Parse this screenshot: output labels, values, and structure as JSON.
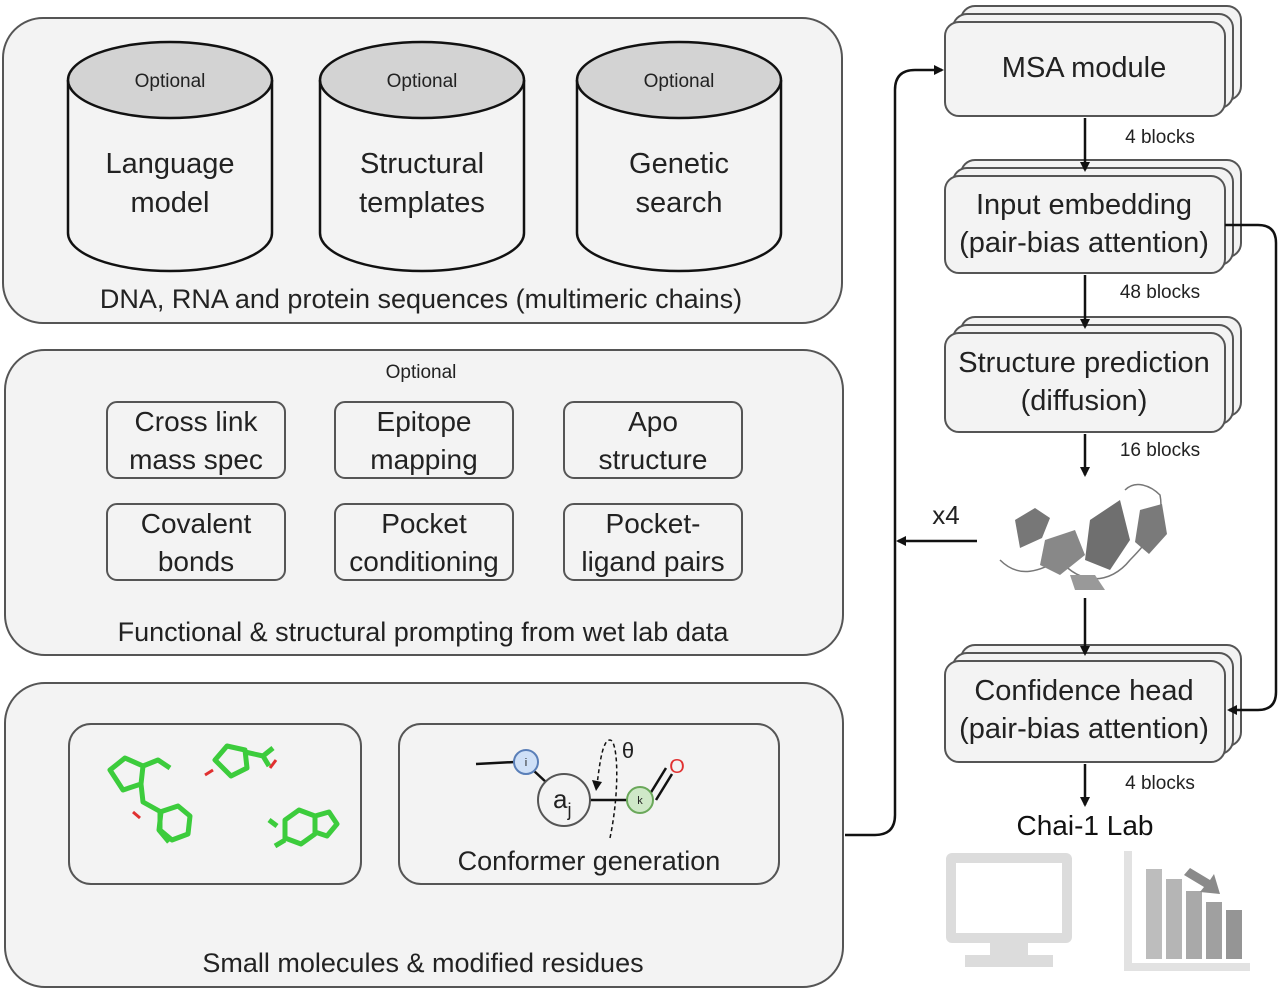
{
  "inputs": {
    "sequences": {
      "databases": [
        {
          "tag": "Optional",
          "line1": "Language",
          "line2": "model"
        },
        {
          "tag": "Optional",
          "line1": "Structural",
          "line2": "templates"
        },
        {
          "tag": "Optional",
          "line1": "Genetic",
          "line2": "search"
        }
      ],
      "caption": "DNA, RNA and protein sequences (multimeric chains)"
    },
    "prompting": {
      "tag": "Optional",
      "items": [
        {
          "line1": "Cross link",
          "line2": "mass spec"
        },
        {
          "line1": "Epitope",
          "line2": "mapping"
        },
        {
          "line1": "Apo",
          "line2": "structure"
        },
        {
          "line1": "Covalent",
          "line2": "bonds"
        },
        {
          "line1": "Pocket",
          "line2": "conditioning"
        },
        {
          "line1": "Pocket-",
          "line2": "ligand pairs"
        }
      ],
      "caption": "Functional & structural prompting from wet lab data"
    },
    "small_molecules": {
      "conformer": {
        "atom_i": "i",
        "atom_j": "a",
        "atom_j_sub": "j",
        "atom_k": "k",
        "oxygen": "O",
        "angle": "θ",
        "caption": "Conformer generation"
      },
      "caption": "Small molecules & modified residues"
    }
  },
  "pipeline": {
    "msa": {
      "label": "MSA module",
      "blocks": "4 blocks"
    },
    "embedding": {
      "line1": "Input embedding",
      "line2": "(pair-bias attention)",
      "blocks": "48 blocks"
    },
    "structure": {
      "line1": "Structure prediction",
      "line2": "(diffusion)",
      "blocks": "16 blocks"
    },
    "recycle": "x4",
    "confidence": {
      "line1": "Confidence head",
      "line2": "(pair-bias attention)",
      "blocks": "4 blocks"
    },
    "output": "Chai-1 Lab"
  },
  "colors": {
    "panel": "#f3f3f3",
    "atom_i": "#cfe0f7",
    "atom_k": "#cfe8c8",
    "oxygen": "#e03030",
    "molecule": "#3ccc3c"
  }
}
